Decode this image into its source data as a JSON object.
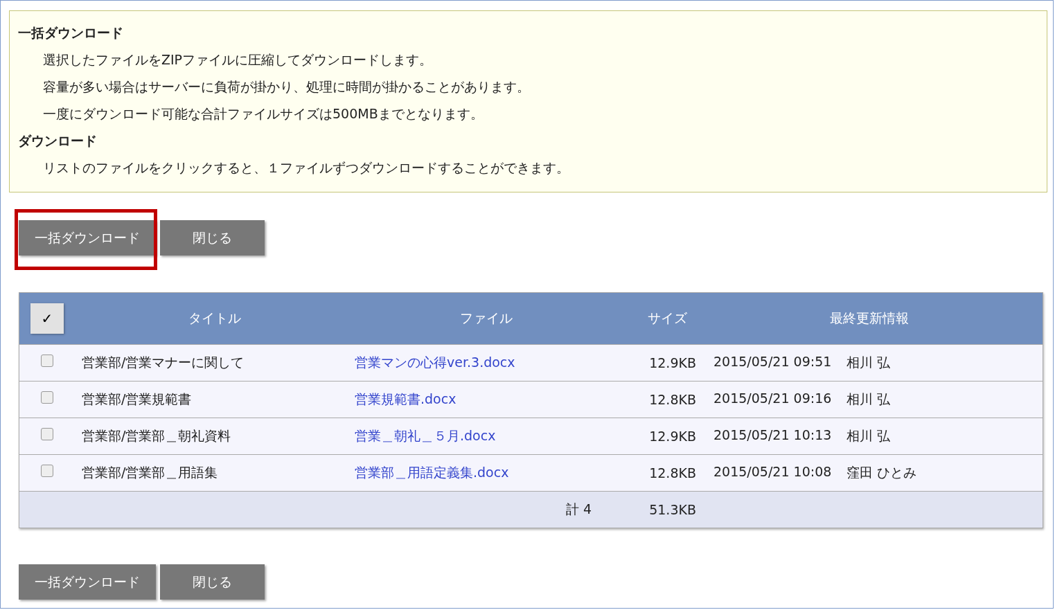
{
  "info": [
    {
      "heading": "一括ダウンロード",
      "lines": [
        "選択したファイルをZIPファイルに圧縮してダウンロードします。",
        "容量が多い場合はサーバーに負荷が掛かり、処理に時間が掛かることがあります。",
        "一度にダウンロード可能な合計ファイルサイズは500MBまでとなります。"
      ]
    },
    {
      "heading": "ダウンロード",
      "lines": [
        "リストのファイルをクリックすると、１ファイルずつダウンロードすることができます。"
      ]
    }
  ],
  "top_buttons": {
    "highlighted": true,
    "buttons": [
      "一括ダウンロード",
      "閉じる"
    ]
  },
  "table": {
    "select_all": "✓",
    "columns": [
      "タイトル",
      "ファイル",
      "サイズ",
      "最終更新情報"
    ],
    "rows": [
      {
        "checked": false,
        "title": "営業部/営業マナーに関して",
        "file": "営業マンの心得ver.3.docx",
        "size": "12.9KB",
        "updated": "2015/05/21 09:51",
        "user": "相川 弘"
      },
      {
        "checked": false,
        "title": "営業部/営業規範書",
        "file": "営業規範書.docx",
        "size": "12.8KB",
        "updated": "2015/05/21 09:16",
        "user": "相川 弘"
      },
      {
        "checked": false,
        "title": "営業部/営業部＿朝礼資料",
        "file": "営業＿朝礼＿５月.docx",
        "size": "12.9KB",
        "updated": "2015/05/21 10:13",
        "user": "相川 弘"
      },
      {
        "checked": false,
        "title": "営業部/営業部＿用語集",
        "file": "営業部＿用語定義集.docx",
        "size": "12.8KB",
        "updated": "2015/05/21 10:08",
        "user": "窪田 ひとみ"
      }
    ],
    "total": {
      "count": "計 4",
      "size": "51.3KB"
    }
  },
  "bottom_buttons": {
    "buttons": [
      "一括ダウンロード",
      "閉じる"
    ]
  }
}
